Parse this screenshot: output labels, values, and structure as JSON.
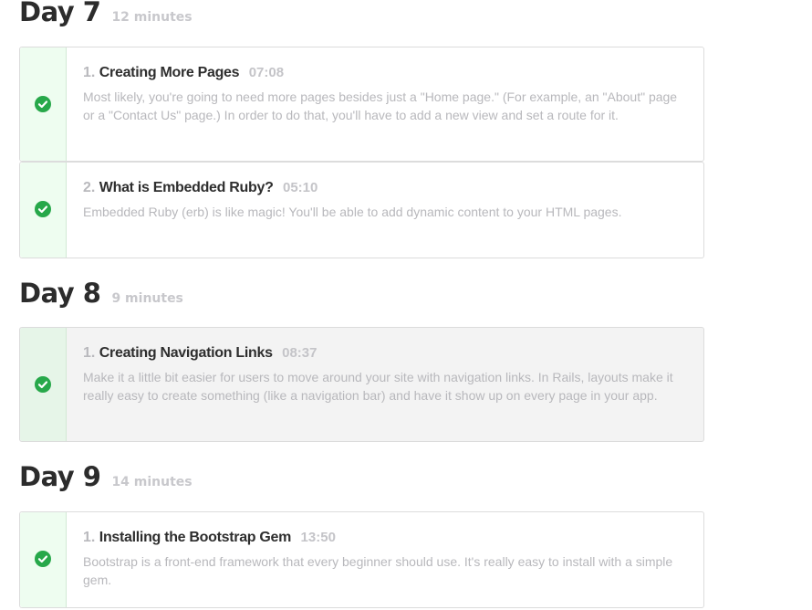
{
  "days": [
    {
      "title": "Day 7",
      "duration": "12 minutes",
      "lessons": [
        {
          "number": "1.",
          "title": "Creating More Pages",
          "time": "07:08",
          "description": "Most likely, you're going to need more pages besides just a \"Home page.\" (For example, an \"About\" page or a \"Contact Us\" page.) In order to do that, you'll have to add a new view and set a route for it.",
          "completed_icon": "check-circle-icon"
        },
        {
          "number": "2.",
          "title": "What is Embedded Ruby?",
          "time": "05:10",
          "description": "Embedded Ruby (erb) is like magic! You'll be able to add dynamic content to your HTML pages.",
          "completed_icon": "check-circle-icon"
        }
      ]
    },
    {
      "title": "Day 8",
      "duration": "9 minutes",
      "lessons": [
        {
          "number": "1.",
          "title": "Creating Navigation Links",
          "time": "08:37",
          "description": "Make it a little bit easier for users to move around your site with navigation links. In Rails, layouts make it really easy to create something (like a navigation bar) and have it show up on every page in your app.",
          "completed_icon": "check-circle-icon"
        }
      ]
    },
    {
      "title": "Day 9",
      "duration": "14 minutes",
      "lessons": [
        {
          "number": "1.",
          "title": "Installing the Bootstrap Gem",
          "time": "13:50",
          "description": "Bootstrap is a front-end framework that every beginner should use. It's really easy to install with a simple gem.",
          "completed_icon": "check-circle-icon"
        }
      ]
    }
  ],
  "colors": {
    "check_green": "#27a84a",
    "completed_bg": "#eefdf0"
  }
}
